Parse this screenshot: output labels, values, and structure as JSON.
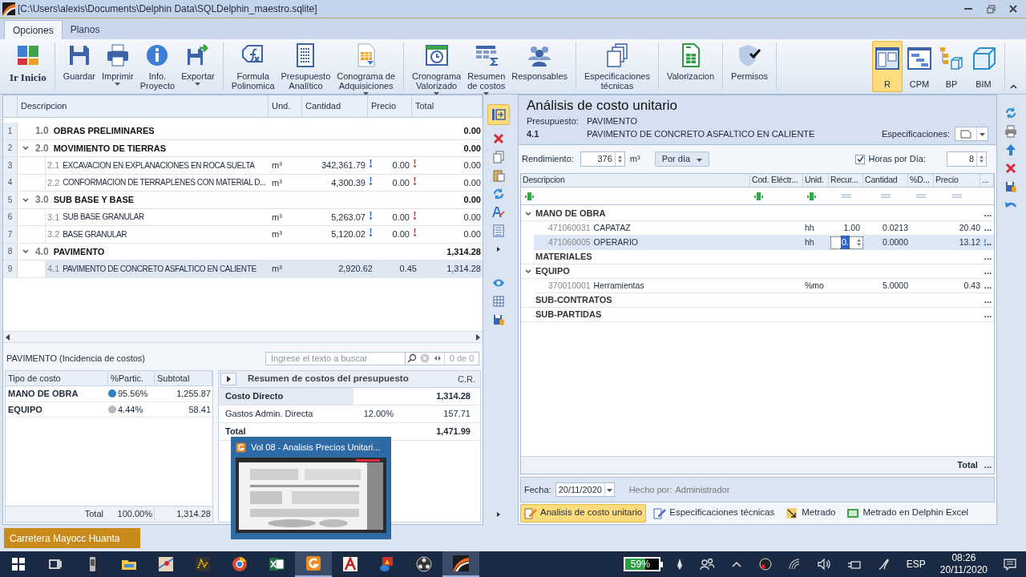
{
  "window": {
    "title": "[C:\\Users\\alexis\\Documents\\Delphin Data\\SQLDelphin_maestro.sqlite]"
  },
  "tabs": [
    {
      "label": "Opciones",
      "selected": true
    },
    {
      "label": "Planos",
      "selected": false
    }
  ],
  "ribbon": {
    "groups": [
      [
        {
          "lines": [
            "Ir Inicio"
          ],
          "large": true,
          "dropdown": false
        }
      ],
      [
        {
          "lines": [
            "Guardar"
          ],
          "large": false,
          "dropdown": false
        },
        {
          "lines": [
            "Imprimir"
          ],
          "large": false,
          "dropdown": true
        },
        {
          "lines": [
            "Info.",
            "Proyecto"
          ],
          "large": false,
          "dropdown": false
        },
        {
          "lines": [
            "Exportar"
          ],
          "large": false,
          "dropdown": true
        }
      ],
      [
        {
          "lines": [
            "Formula",
            "Polinomica"
          ],
          "large": false,
          "dropdown": false
        },
        {
          "lines": [
            "Presupuesto",
            "Analítico"
          ],
          "large": false,
          "dropdown": false
        },
        {
          "lines": [
            "Conograma de",
            "Adquisiciones"
          ],
          "large": false,
          "dropdown": true
        }
      ],
      [
        {
          "lines": [
            "Cronograma",
            "Valorizado"
          ],
          "large": false,
          "dropdown": true
        },
        {
          "lines": [
            "Resumen",
            "de costos"
          ],
          "large": false,
          "dropdown": true
        },
        {
          "lines": [
            "Responsables"
          ],
          "large": false,
          "dropdown": false
        }
      ],
      [
        {
          "lines": [
            "Especificaciones",
            "técnicas"
          ],
          "large": false,
          "dropdown": false
        }
      ],
      [
        {
          "lines": [
            "Valorizacion"
          ],
          "large": false,
          "dropdown": false
        }
      ],
      [
        {
          "lines": [
            "Permisos"
          ],
          "large": false,
          "dropdown": false
        }
      ]
    ],
    "views": [
      {
        "label": "R",
        "selected": true
      },
      {
        "label": "CPM",
        "selected": false
      },
      {
        "label": "BP",
        "selected": false
      },
      {
        "label": "BIM",
        "selected": false
      }
    ]
  },
  "budget_table": {
    "columns": [
      "Descripcion",
      "Und.",
      "Cantidad",
      "Precio",
      "Total"
    ],
    "groups": [
      {
        "num": "1",
        "code": "1.0",
        "label": "OBRAS PRELIMINARES",
        "total": "0.00",
        "expanded": false
      },
      {
        "num": "2",
        "code": "2.0",
        "label": "MOVIMIENTO DE TIERRAS",
        "total": "0.00",
        "expanded": true,
        "children": [
          {
            "num": "3",
            "code": "2.1",
            "label": "EXCAVACION EN EXPLANACIONES EN ROCA SUELTA",
            "unit": "m³",
            "quantity": "342,361.79",
            "price": "0.00",
            "total": "0.00",
            "quantity_flag": true,
            "price_flag": true,
            "selected": false
          },
          {
            "num": "4",
            "code": "2.2",
            "label": "CONFORMACION DE TERRAPLENES CON MATERIAL D...",
            "unit": "m³",
            "quantity": "4,300.39",
            "price": "0.00",
            "total": "0.00",
            "quantity_flag": true,
            "price_flag": true,
            "selected": false
          }
        ]
      },
      {
        "num": "5",
        "code": "3.0",
        "label": "SUB BASE Y BASE",
        "total": "0.00",
        "expanded": true,
        "children": [
          {
            "num": "6",
            "code": "3.1",
            "label": "SUB BASE GRANULAR",
            "unit": "m³",
            "quantity": "5,263.07",
            "price": "0.00",
            "total": "0.00",
            "quantity_flag": true,
            "price_flag": true,
            "selected": false
          },
          {
            "num": "7",
            "code": "3.2",
            "label": "BASE GRANULAR",
            "unit": "m³",
            "quantity": "5,120.02",
            "price": "0.00",
            "total": "0.00",
            "quantity_flag": true,
            "price_flag": true,
            "selected": false
          }
        ]
      },
      {
        "num": "8",
        "code": "4.0",
        "label": "PAVIMENTO",
        "total": "1,314.28",
        "expanded": true,
        "children": [
          {
            "num": "9",
            "code": "4.1",
            "label": "PAVIMENTO DE CONCRETO ASFALTICO EN CALIENTE",
            "unit": "m³",
            "quantity": "2,920.62",
            "price": "0.45",
            "total": "1,314.28",
            "quantity_flag": false,
            "price_flag": false,
            "selected": true
          }
        ]
      }
    ]
  },
  "incidence": {
    "title": "PAVIMENTO (Incidencia de costos)",
    "columns": [
      "Tipo de costo",
      "%Partic.",
      "Subtotal"
    ],
    "rows": [
      {
        "type": "MANO DE OBRA",
        "share": "95.56%",
        "subtotal": "1,255.87",
        "color": "#2f7fc1"
      },
      {
        "type": "EQUIPO",
        "share": "4.44%",
        "subtotal": "58.41",
        "color": "#b4b9c0"
      }
    ],
    "total": {
      "label": "Total",
      "share": "100.00%",
      "subtotal": "1,314.28"
    }
  },
  "search": {
    "placeholder": "Ingrese el texto a buscar",
    "count": "0 de 0"
  },
  "summary": {
    "title": "Resumen de costos del presupuesto",
    "column": "C.R.",
    "rows": [
      {
        "label": "Costo Directo",
        "value": "1,314.28",
        "bold": true
      },
      {
        "label": "Gastos Admin. Directa",
        "rate": "12.00%",
        "value": "157.71",
        "bold": false
      },
      {
        "label": "Total",
        "value": "1,471.99",
        "bold": true
      }
    ]
  },
  "analysis": {
    "title": "Análisis de costo unitario",
    "budget_label": "Presupuesto:",
    "budget": "PAVIMENTO",
    "code": "4.1",
    "description": "PAVIMENTO DE CONCRETO ASFALTICO EN CALIENTE",
    "specs_label": "Especificaciones:",
    "yield_label": "Rendimiento:",
    "yield": "376",
    "unit": "m³",
    "period": "Por día",
    "hours_label": "Horas por Día:",
    "hours_checked": true,
    "hours": "8"
  },
  "resources": {
    "columns": [
      "Descripcion",
      "Cod. Eléctr...",
      "Unid.",
      "Recur...",
      "Cantidad",
      "%D...",
      "Precio",
      "..."
    ],
    "groups": [
      {
        "label": "MANO DE OBRA",
        "expanded": true,
        "more": "...",
        "children": [
          {
            "code": "471060031",
            "label": "CAPATAZ",
            "unit": "hh",
            "resources": "1.00",
            "quantity": "0.0213",
            "price": "20.40",
            "more": "...",
            "selected": false,
            "editing": false,
            "flag": false
          },
          {
            "code": "471060005",
            "label": "OPERARIO",
            "unit": "hh",
            "resources": "0.",
            "quantity": "0.0000",
            "price": "13.12",
            "more": "..",
            "selected": true,
            "editing": true,
            "flag": true
          }
        ]
      },
      {
        "label": "MATERIALES",
        "expanded": false,
        "more": "..."
      },
      {
        "label": "EQUIPO",
        "expanded": true,
        "more": "...",
        "children": [
          {
            "code": "370010001",
            "label": "Herramientas",
            "unit": "%mo",
            "quantity": "5.0000",
            "price": "0.43",
            "more": "...",
            "selected": false,
            "editing": false,
            "flag": false
          }
        ]
      },
      {
        "label": "SUB-CONTRATOS",
        "expanded": false,
        "more": "..."
      },
      {
        "label": "SUB-PARTIDAS",
        "expanded": false,
        "more": "..."
      }
    ],
    "footer": {
      "label": "Total",
      "more": "..."
    }
  },
  "footer": {
    "date_label": "Fecha:",
    "date": "20/11/2020",
    "by_label": "Hecho por:",
    "by": "Administrador"
  },
  "bottom_tabs": [
    {
      "label": "Analisis de costo unitario",
      "selected": true
    },
    {
      "label": "Especificaciones técnicas",
      "selected": false
    },
    {
      "label": "Metrado",
      "selected": false
    },
    {
      "label": "Metrado en Delphin Excel",
      "selected": false
    }
  ],
  "project_tab": {
    "label": "Carretera Mayocc Huanta"
  },
  "preview": {
    "title": "Vol 08 - Analisis Precios Unitari..."
  },
  "taskbar": {
    "battery": "59%",
    "language": "ESP",
    "time": "08:26",
    "date": "20/11/2020"
  }
}
